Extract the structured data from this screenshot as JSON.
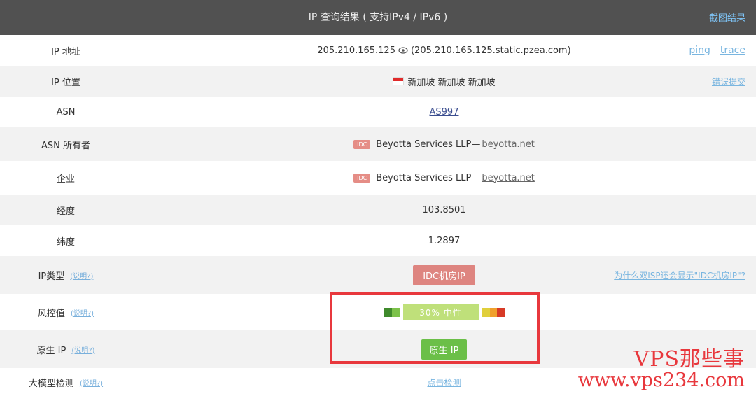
{
  "header": {
    "title": "IP 查询结果 ( 支持IPv4 / IPv6 )",
    "screenshot_link": "截图结果"
  },
  "rows": {
    "ip": {
      "label": "IP 地址",
      "address": "205.210.165.125",
      "hostname": "(205.210.165.125.static.pzea.com)",
      "ping": "ping",
      "trace": "trace"
    },
    "location": {
      "label": "IP 位置",
      "value": "新加坡 新加坡 新加坡",
      "report": "错误提交"
    },
    "asn": {
      "label": "ASN",
      "value": "AS997"
    },
    "asn_owner": {
      "label": "ASN 所有者",
      "badge": "IDC",
      "name": "Beyotta Services LLP—",
      "domain": "beyotta.net"
    },
    "company": {
      "label": "企业",
      "badge": "IDC",
      "name": "Beyotta Services LLP—",
      "domain": "beyotta.net"
    },
    "longitude": {
      "label": "经度",
      "value": "103.8501"
    },
    "latitude": {
      "label": "纬度",
      "value": "1.2897"
    },
    "ip_type": {
      "label": "IP类型",
      "help": "(说明?)",
      "badge": "IDC机房IP",
      "question": "为什么双ISP还会显示\"IDC机房IP\"?"
    },
    "risk": {
      "label": "风控值",
      "help": "(说明?)",
      "value_text": "30%  中性",
      "percent": 30
    },
    "native": {
      "label": "原生 IP",
      "help": "(说明?)",
      "badge": "原生 IP"
    },
    "llm": {
      "label": "大模型检测",
      "help": "(说明?)",
      "action": "点击检测"
    }
  },
  "watermark": {
    "line1": "VPS那些事",
    "line2": "www.vps234.com"
  },
  "colors": {
    "header_bg": "#515151",
    "alt_row_bg": "#f2f2f2",
    "highlight": "#e8383d",
    "idc_badge": "#de8580",
    "native_badge": "#6bbf48",
    "risk_bar": "#bfe07a"
  }
}
